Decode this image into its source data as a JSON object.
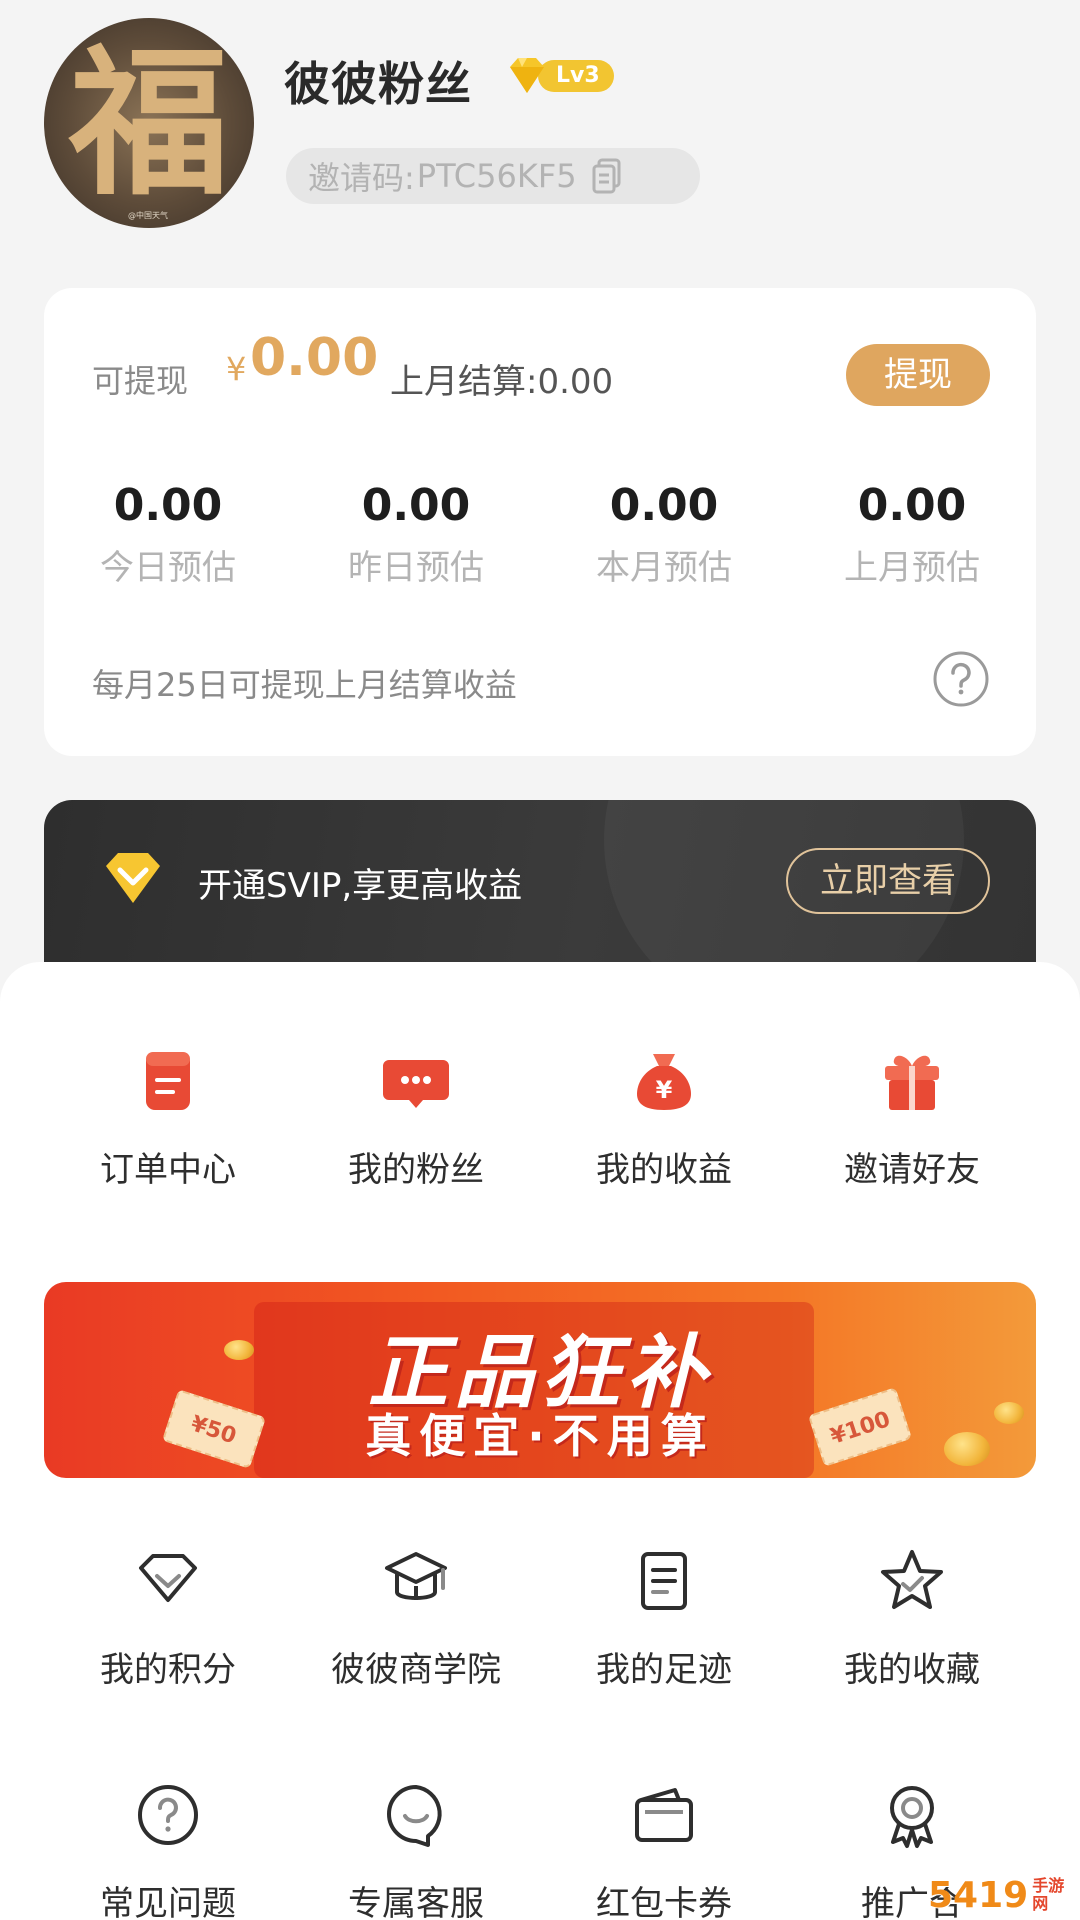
{
  "profile": {
    "avatar_glyph": "福",
    "avatar_watermark": "@中国天气",
    "username": "彼彼粉丝",
    "level": "Lv3",
    "invite_label": "邀请码:",
    "invite_code": "PTC56KF5"
  },
  "earnings": {
    "withdrawable_label": "可提现",
    "currency": "¥",
    "withdrawable_amount": "0.00",
    "last_month_settled": "上月结算:0.00",
    "withdraw_button": "提现",
    "stats": [
      {
        "value": "0.00",
        "label": "今日预估"
      },
      {
        "value": "0.00",
        "label": "昨日预估"
      },
      {
        "value": "0.00",
        "label": "本月预估"
      },
      {
        "value": "0.00",
        "label": "上月预估"
      }
    ],
    "note": "每月25日可提现上月结算收益"
  },
  "svip": {
    "text": "开通SVIP,享更高收益",
    "button": "立即查看"
  },
  "quick_menu": [
    {
      "label": "订单中心",
      "icon": "order-icon"
    },
    {
      "label": "我的粉丝",
      "icon": "chat-icon"
    },
    {
      "label": "我的收益",
      "icon": "money-bag-icon"
    },
    {
      "label": "邀请好友",
      "icon": "gift-icon"
    }
  ],
  "promo": {
    "title": "正品狂补",
    "subtitle": "真便宜·不用算",
    "ticket_left": "¥50",
    "ticket_right": "¥100"
  },
  "service_menu": [
    {
      "label": "我的积分",
      "icon": "points-icon"
    },
    {
      "label": "彼彼商学院",
      "icon": "graduation-cap-icon"
    },
    {
      "label": "我的足迹",
      "icon": "footprint-icon"
    },
    {
      "label": "我的收藏",
      "icon": "star-icon"
    },
    {
      "label": "常见问题",
      "icon": "faq-icon"
    },
    {
      "label": "专属客服",
      "icon": "customer-service-icon"
    },
    {
      "label": "红包卡券",
      "icon": "wallet-icon"
    },
    {
      "label": "推广合",
      "icon": "badge-icon"
    }
  ],
  "watermark": {
    "main": "5419",
    "small": "手游网"
  },
  "colors": {
    "accent_gold": "#dfa65f",
    "menu_red": "#e84a35",
    "dark_bar": "#333333"
  }
}
